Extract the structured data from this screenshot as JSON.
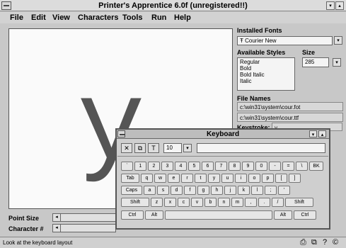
{
  "window": {
    "title": "Printer's Apprentice 6.0f (unregistered!!)"
  },
  "menu": [
    "File",
    "Edit",
    "View",
    "Characters",
    "Tools",
    "Run",
    "Help"
  ],
  "preview": {
    "glyph": "y"
  },
  "fonts": {
    "installed_label": "Installed Fonts",
    "selected_font": "Courier New",
    "styles_label": "Available Styles",
    "styles": [
      "Regular",
      "Bold",
      "Bold Italic",
      "Italic"
    ],
    "size_label": "Size",
    "size_value": "285",
    "file_names_label": "File Names",
    "files": [
      "c:\\win31\\system\\cour.fot",
      "c:\\win31\\system\\cour.ttf"
    ],
    "keystroke_label": "Keystroke:",
    "keystroke_value": "y"
  },
  "bottom": {
    "point_size_label": "Point Size",
    "character_label": "Character #"
  },
  "keyboard": {
    "title": "Keyboard",
    "size_value": "10",
    "row1": [
      "`",
      "1",
      "2",
      "3",
      "4",
      "5",
      "6",
      "7",
      "8",
      "9",
      "0",
      "-",
      "=",
      "\\",
      "BK"
    ],
    "row2": [
      "Tab",
      "q",
      "w",
      "e",
      "r",
      "t",
      "y",
      "u",
      "i",
      "o",
      "p",
      "[",
      "]"
    ],
    "row3": [
      "Caps",
      "a",
      "s",
      "d",
      "f",
      "g",
      "h",
      "j",
      "k",
      "l",
      ";",
      "'"
    ],
    "row4": [
      "Shift",
      "z",
      "x",
      "c",
      "v",
      "b",
      "n",
      "m",
      ",",
      ".",
      "/",
      "Shift"
    ],
    "row5": [
      "Ctrl",
      "Alt",
      "",
      "Alt",
      "Ctrl"
    ]
  },
  "status": {
    "text": "Look at the keyboard layout"
  }
}
